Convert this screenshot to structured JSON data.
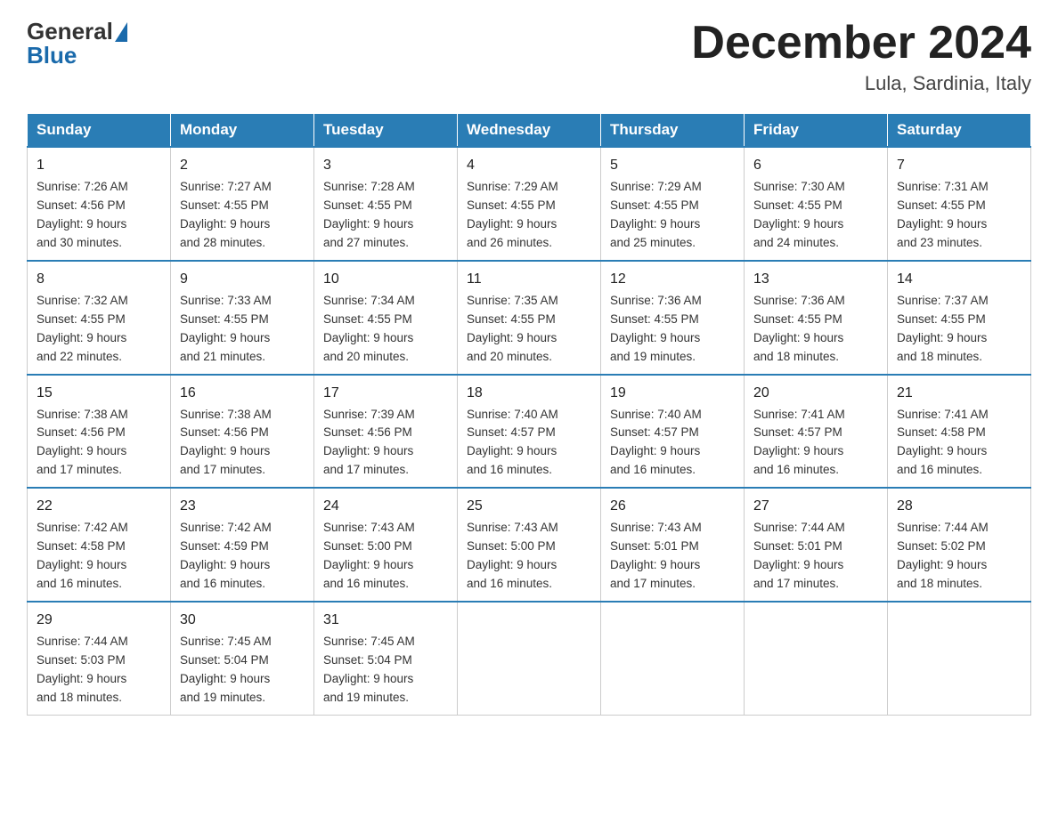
{
  "logo": {
    "general": "General",
    "blue": "Blue"
  },
  "title": "December 2024",
  "subtitle": "Lula, Sardinia, Italy",
  "days_of_week": [
    "Sunday",
    "Monday",
    "Tuesday",
    "Wednesday",
    "Thursday",
    "Friday",
    "Saturday"
  ],
  "weeks": [
    [
      {
        "day": "1",
        "sunrise": "7:26 AM",
        "sunset": "4:56 PM",
        "daylight": "9 hours and 30 minutes."
      },
      {
        "day": "2",
        "sunrise": "7:27 AM",
        "sunset": "4:55 PM",
        "daylight": "9 hours and 28 minutes."
      },
      {
        "day": "3",
        "sunrise": "7:28 AM",
        "sunset": "4:55 PM",
        "daylight": "9 hours and 27 minutes."
      },
      {
        "day": "4",
        "sunrise": "7:29 AM",
        "sunset": "4:55 PM",
        "daylight": "9 hours and 26 minutes."
      },
      {
        "day": "5",
        "sunrise": "7:29 AM",
        "sunset": "4:55 PM",
        "daylight": "9 hours and 25 minutes."
      },
      {
        "day": "6",
        "sunrise": "7:30 AM",
        "sunset": "4:55 PM",
        "daylight": "9 hours and 24 minutes."
      },
      {
        "day": "7",
        "sunrise": "7:31 AM",
        "sunset": "4:55 PM",
        "daylight": "9 hours and 23 minutes."
      }
    ],
    [
      {
        "day": "8",
        "sunrise": "7:32 AM",
        "sunset": "4:55 PM",
        "daylight": "9 hours and 22 minutes."
      },
      {
        "day": "9",
        "sunrise": "7:33 AM",
        "sunset": "4:55 PM",
        "daylight": "9 hours and 21 minutes."
      },
      {
        "day": "10",
        "sunrise": "7:34 AM",
        "sunset": "4:55 PM",
        "daylight": "9 hours and 20 minutes."
      },
      {
        "day": "11",
        "sunrise": "7:35 AM",
        "sunset": "4:55 PM",
        "daylight": "9 hours and 20 minutes."
      },
      {
        "day": "12",
        "sunrise": "7:36 AM",
        "sunset": "4:55 PM",
        "daylight": "9 hours and 19 minutes."
      },
      {
        "day": "13",
        "sunrise": "7:36 AM",
        "sunset": "4:55 PM",
        "daylight": "9 hours and 18 minutes."
      },
      {
        "day": "14",
        "sunrise": "7:37 AM",
        "sunset": "4:55 PM",
        "daylight": "9 hours and 18 minutes."
      }
    ],
    [
      {
        "day": "15",
        "sunrise": "7:38 AM",
        "sunset": "4:56 PM",
        "daylight": "9 hours and 17 minutes."
      },
      {
        "day": "16",
        "sunrise": "7:38 AM",
        "sunset": "4:56 PM",
        "daylight": "9 hours and 17 minutes."
      },
      {
        "day": "17",
        "sunrise": "7:39 AM",
        "sunset": "4:56 PM",
        "daylight": "9 hours and 17 minutes."
      },
      {
        "day": "18",
        "sunrise": "7:40 AM",
        "sunset": "4:57 PM",
        "daylight": "9 hours and 16 minutes."
      },
      {
        "day": "19",
        "sunrise": "7:40 AM",
        "sunset": "4:57 PM",
        "daylight": "9 hours and 16 minutes."
      },
      {
        "day": "20",
        "sunrise": "7:41 AM",
        "sunset": "4:57 PM",
        "daylight": "9 hours and 16 minutes."
      },
      {
        "day": "21",
        "sunrise": "7:41 AM",
        "sunset": "4:58 PM",
        "daylight": "9 hours and 16 minutes."
      }
    ],
    [
      {
        "day": "22",
        "sunrise": "7:42 AM",
        "sunset": "4:58 PM",
        "daylight": "9 hours and 16 minutes."
      },
      {
        "day": "23",
        "sunrise": "7:42 AM",
        "sunset": "4:59 PM",
        "daylight": "9 hours and 16 minutes."
      },
      {
        "day": "24",
        "sunrise": "7:43 AM",
        "sunset": "5:00 PM",
        "daylight": "9 hours and 16 minutes."
      },
      {
        "day": "25",
        "sunrise": "7:43 AM",
        "sunset": "5:00 PM",
        "daylight": "9 hours and 16 minutes."
      },
      {
        "day": "26",
        "sunrise": "7:43 AM",
        "sunset": "5:01 PM",
        "daylight": "9 hours and 17 minutes."
      },
      {
        "day": "27",
        "sunrise": "7:44 AM",
        "sunset": "5:01 PM",
        "daylight": "9 hours and 17 minutes."
      },
      {
        "day": "28",
        "sunrise": "7:44 AM",
        "sunset": "5:02 PM",
        "daylight": "9 hours and 18 minutes."
      }
    ],
    [
      {
        "day": "29",
        "sunrise": "7:44 AM",
        "sunset": "5:03 PM",
        "daylight": "9 hours and 18 minutes."
      },
      {
        "day": "30",
        "sunrise": "7:45 AM",
        "sunset": "5:04 PM",
        "daylight": "9 hours and 19 minutes."
      },
      {
        "day": "31",
        "sunrise": "7:45 AM",
        "sunset": "5:04 PM",
        "daylight": "9 hours and 19 minutes."
      },
      {
        "day": "",
        "sunrise": "",
        "sunset": "",
        "daylight": ""
      },
      {
        "day": "",
        "sunrise": "",
        "sunset": "",
        "daylight": ""
      },
      {
        "day": "",
        "sunrise": "",
        "sunset": "",
        "daylight": ""
      },
      {
        "day": "",
        "sunrise": "",
        "sunset": "",
        "daylight": ""
      }
    ]
  ],
  "labels": {
    "sunrise": "Sunrise:",
    "sunset": "Sunset:",
    "daylight": "Daylight:"
  }
}
